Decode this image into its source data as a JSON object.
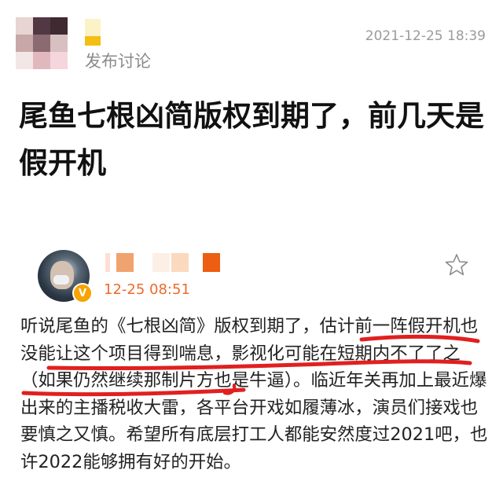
{
  "post": {
    "action": "发布讨论",
    "timestamp": "2021-12-25 18:39",
    "title": "尾鱼七根凶简版权到期了，前几天是假开机"
  },
  "comment": {
    "time": "12-25 08:51",
    "text": "听说尾鱼的《七根凶简》版权到期了，估计前一阵假开机也没能让这个项目得到喘息，影视化可能在短期内不了了之（如果仍然继续那制片方也是牛逼）。临近年关再加上最近爆出来的主播税收大雷，各平台开戏如履薄冰，演员们接戏也要慎之又慎。希望所有底层打工人都能安然度过2021吧，也许2022能够拥有好的开始。",
    "verified_badge": "V",
    "icons": [
      "avatar-mosaic",
      "verified-badge-icon",
      "star-icon"
    ]
  },
  "colors": {
    "timestamp_orange": "#ee6a2c",
    "badge": "#f7a300",
    "scribble": "#e02020"
  }
}
